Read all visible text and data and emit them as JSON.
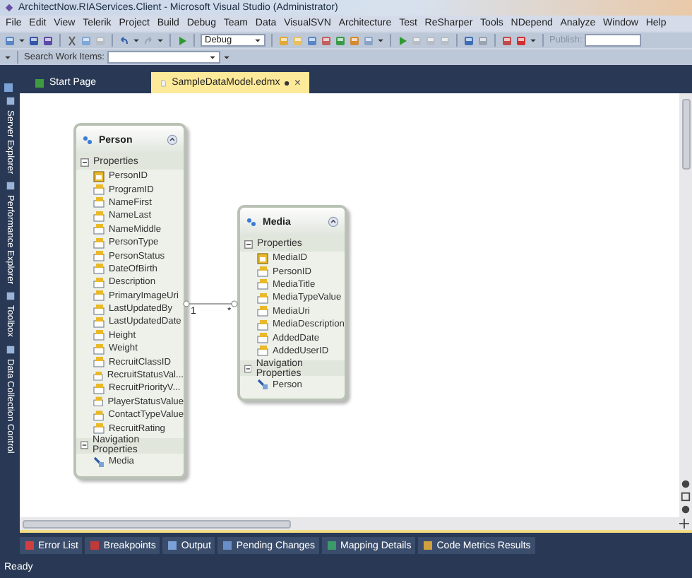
{
  "window": {
    "title": "ArchitectNow.RIAServices.Client - Microsoft Visual Studio (Administrator)"
  },
  "menu": [
    "File",
    "Edit",
    "View",
    "Telerik",
    "Project",
    "Build",
    "Debug",
    "Team",
    "Data",
    "VisualSVN",
    "Architecture",
    "Test",
    "ReSharper",
    "Tools",
    "NDepend",
    "Analyze",
    "Window",
    "Help"
  ],
  "toolbar": {
    "configuration": "Debug",
    "publish": "Publish:"
  },
  "search": {
    "label": "Search Work Items:"
  },
  "tabs": [
    {
      "label": "Start Page",
      "selected": false
    },
    {
      "label": "SampleDataModel.edmx",
      "selected": true,
      "close": "×"
    }
  ],
  "side_panels": [
    "Server Explorer",
    "Performance Explorer",
    "Toolbox",
    "Data Collection Control"
  ],
  "diagram": {
    "entities": [
      {
        "name": "Person",
        "properties_header": "Properties",
        "navigation_header": "Navigation Properties",
        "properties": [
          {
            "name": "PersonID",
            "kind": "key"
          },
          {
            "name": "ProgramID",
            "kind": "scalar"
          },
          {
            "name": "NameFirst",
            "kind": "scalar"
          },
          {
            "name": "NameLast",
            "kind": "scalar"
          },
          {
            "name": "NameMiddle",
            "kind": "scalar"
          },
          {
            "name": "PersonType",
            "kind": "scalar"
          },
          {
            "name": "PersonStatus",
            "kind": "scalar"
          },
          {
            "name": "DateOfBirth",
            "kind": "scalar"
          },
          {
            "name": "Description",
            "kind": "scalar"
          },
          {
            "name": "PrimaryImageUri",
            "kind": "scalar"
          },
          {
            "name": "LastUpdatedBy",
            "kind": "scalar"
          },
          {
            "name": "LastUpdatedDate",
            "kind": "scalar"
          },
          {
            "name": "Height",
            "kind": "scalar"
          },
          {
            "name": "Weight",
            "kind": "scalar"
          },
          {
            "name": "RecruitClassID",
            "kind": "scalar"
          },
          {
            "name": "RecruitStatusVal...",
            "kind": "scalar"
          },
          {
            "name": "RecruitPriorityV...",
            "kind": "scalar"
          },
          {
            "name": "PlayerStatusValue",
            "kind": "scalar"
          },
          {
            "name": "ContactTypeValue",
            "kind": "scalar"
          },
          {
            "name": "RecruitRating",
            "kind": "scalar"
          }
        ],
        "navigation": [
          "Media"
        ]
      },
      {
        "name": "Media",
        "properties_header": "Properties",
        "navigation_header": "Navigation Properties",
        "properties": [
          {
            "name": "MediaID",
            "kind": "key"
          },
          {
            "name": "PersonID",
            "kind": "scalar"
          },
          {
            "name": "MediaTitle",
            "kind": "scalar"
          },
          {
            "name": "MediaTypeValue",
            "kind": "scalar"
          },
          {
            "name": "MediaUri",
            "kind": "scalar"
          },
          {
            "name": "MediaDescription",
            "kind": "scalar"
          },
          {
            "name": "AddedDate",
            "kind": "scalar"
          },
          {
            "name": "AddedUserID",
            "kind": "scalar"
          }
        ],
        "navigation": [
          "Person"
        ]
      }
    ],
    "association": {
      "source_end": "1",
      "target_end": "*"
    }
  },
  "bottom_tabs": [
    "Error List",
    "Breakpoints",
    "Output",
    "Pending Changes",
    "Mapping Details",
    "Code Metrics Results"
  ],
  "status": "Ready"
}
